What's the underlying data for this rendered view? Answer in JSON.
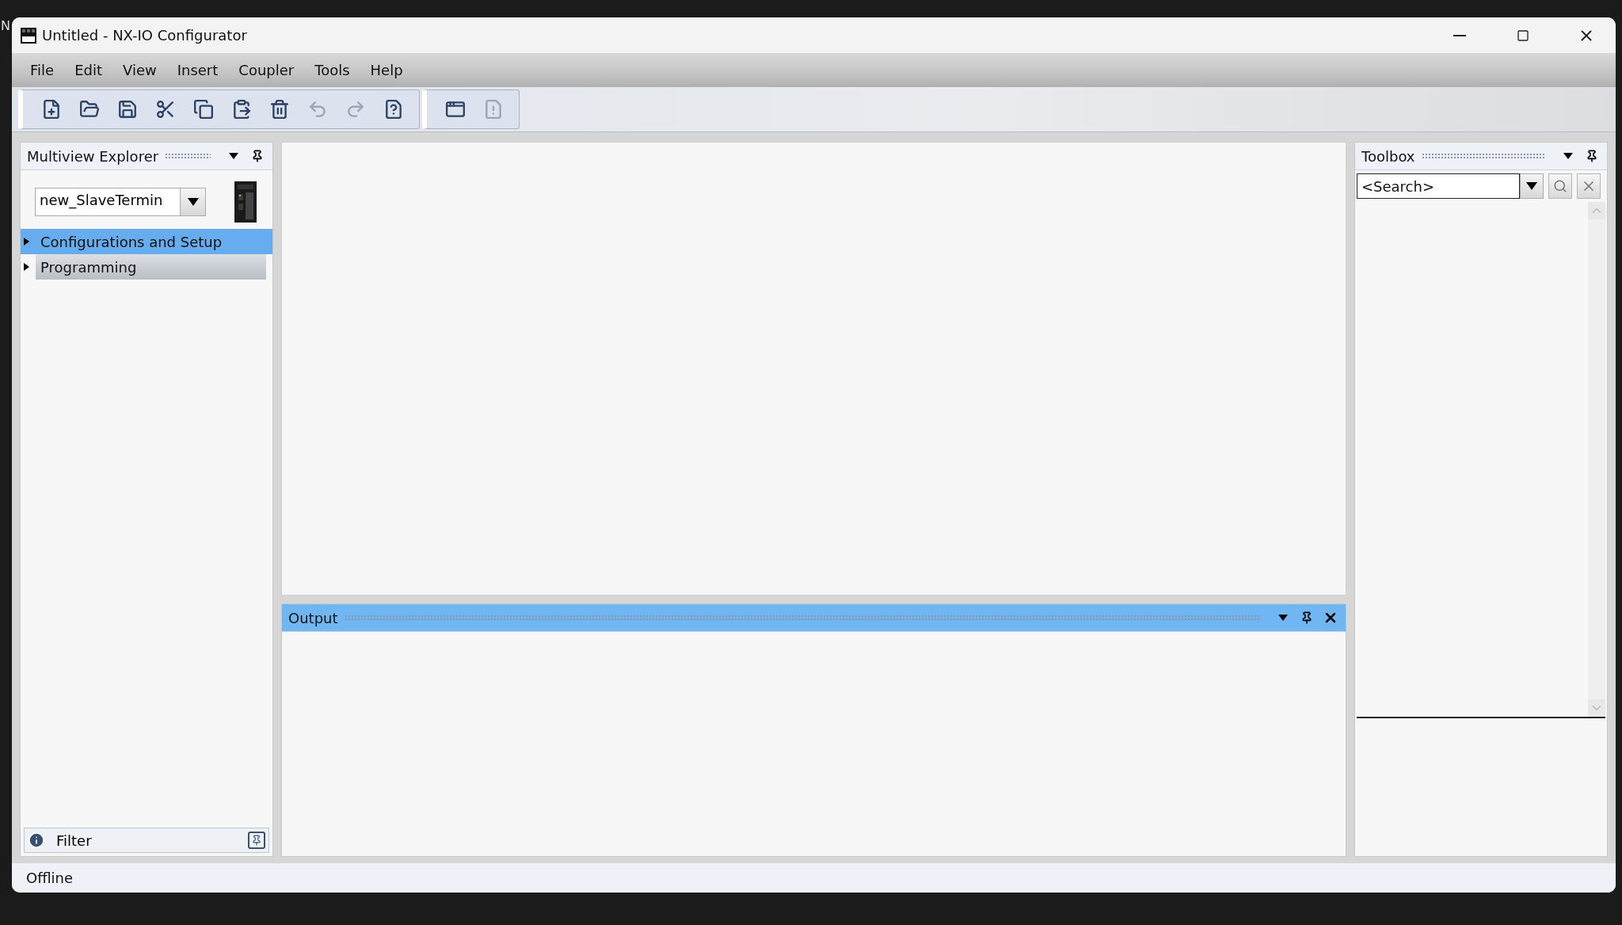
{
  "desktop": {
    "label": "N"
  },
  "window": {
    "title": "Untitled - NX-IO Configurator"
  },
  "menu": [
    "File",
    "Edit",
    "View",
    "Insert",
    "Coupler",
    "Tools",
    "Help"
  ],
  "toolbar": [
    [
      {
        "kind": "new",
        "disabled": false
      },
      {
        "kind": "open",
        "disabled": false
      },
      {
        "kind": "save",
        "disabled": false
      },
      {
        "kind": "cut",
        "disabled": false
      },
      {
        "kind": "copy",
        "disabled": false
      },
      {
        "kind": "paste",
        "disabled": false
      },
      {
        "kind": "delete",
        "disabled": false
      },
      {
        "kind": "undo",
        "disabled": true
      },
      {
        "kind": "redo",
        "disabled": true
      },
      {
        "kind": "help",
        "disabled": false
      }
    ],
    [
      {
        "kind": "windows",
        "disabled": false
      },
      {
        "kind": "error",
        "disabled": true
      }
    ]
  ],
  "explorer": {
    "title": "Multiview Explorer",
    "device": "new_SlaveTermin",
    "items": [
      {
        "label": "Configurations and Setup",
        "selected": true
      },
      {
        "label": "Programming",
        "selected": false
      }
    ],
    "filter": "Filter"
  },
  "output": {
    "title": "Output"
  },
  "toolbox": {
    "title": "Toolbox",
    "search": {
      "placeholder": "<Search>"
    }
  },
  "status_bar": "Offline"
}
